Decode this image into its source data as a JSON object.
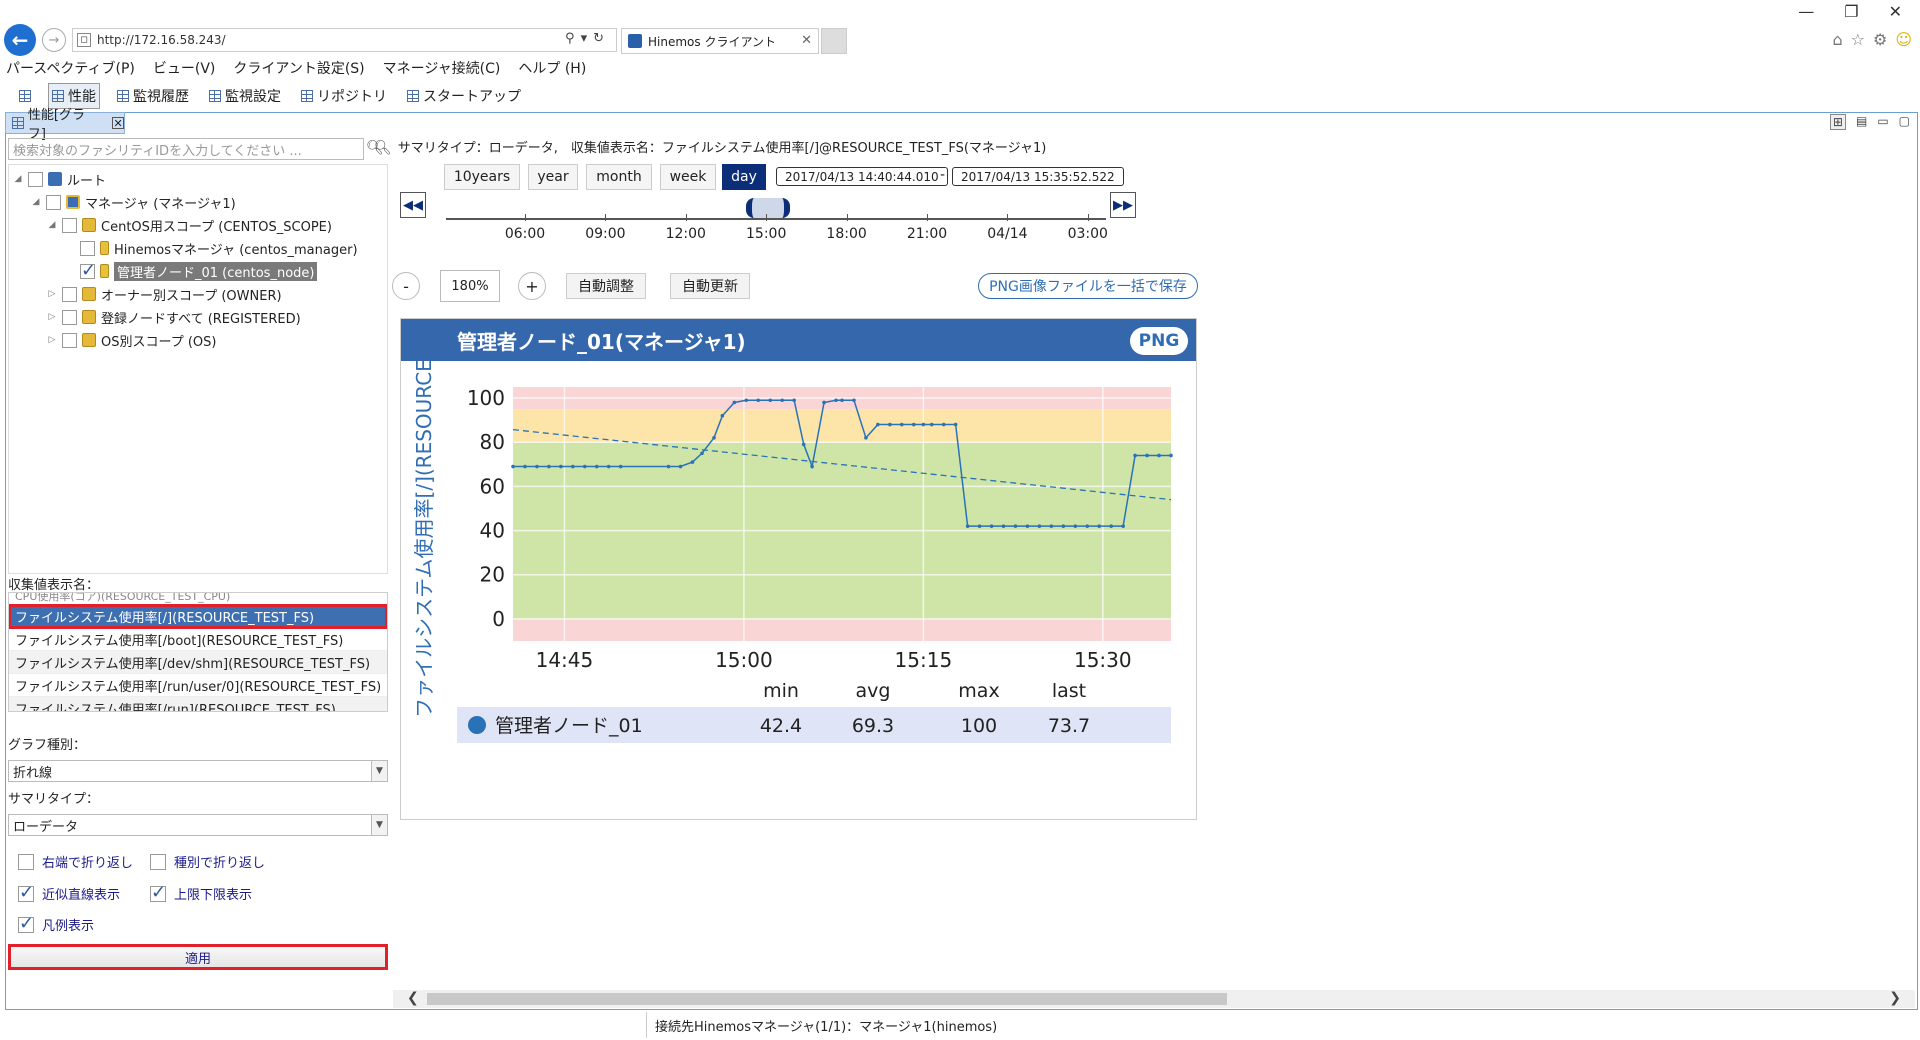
{
  "browser": {
    "url": "http://172.16.58.243/",
    "tab_title": "Hinemos クライアント",
    "window_controls": [
      "—",
      "❐",
      "✕"
    ]
  },
  "menu": [
    "パースペクティブ(P)",
    "ビュー(V)",
    "クライアント設定(S)",
    "マネージャ接続(C)",
    "ヘルプ (H)"
  ],
  "toolbar": [
    "性能",
    "監視履歴",
    "監視設定",
    "リポジトリ",
    "スタートアップ"
  ],
  "view_tab": "性能[グラフ]",
  "left": {
    "search_placeholder": "検索対象のファシリティIDを入力してください ...",
    "tree": [
      {
        "label": "ルート"
      },
      {
        "label": "マネージャ (マネージャ1)"
      },
      {
        "label": "CentOS用スコープ (CENTOS_SCOPE)"
      },
      {
        "label": "Hinemosマネージャ (centos_manager)"
      },
      {
        "label": "管理者ノード_01 (centos_node)"
      },
      {
        "label": "オーナー別スコープ (OWNER)"
      },
      {
        "label": "登録ノードすべて (REGISTERED)"
      },
      {
        "label": "OS別スコープ (OS)"
      }
    ],
    "collect_label": "収集値表示名：",
    "collect_partial_top": "CPU使用率(コア)(RESOURCE_TEST_CPU)",
    "collect_items": [
      "ファイルシステム使用率[/](RESOURCE_TEST_FS)",
      "ファイルシステム使用率[/boot](RESOURCE_TEST_FS)",
      "ファイルシステム使用率[/dev/shm](RESOURCE_TEST_FS)",
      "ファイルシステム使用率[/run/user/0](RESOURCE_TEST_FS)",
      "ファイルシステム使用率[/run](RESOURCE_TEST_FS)"
    ],
    "graph_type_label": "グラフ種別：",
    "graph_type_value": "折れ線",
    "summary_type_label": "サマリタイプ：",
    "summary_type_value": "ローデータ",
    "options": [
      {
        "label": "右端で折り返し",
        "checked": false
      },
      {
        "label": "種別で折り返し",
        "checked": false
      },
      {
        "label": "近似直線表示",
        "checked": true
      },
      {
        "label": "上限下限表示",
        "checked": true
      },
      {
        "label": "凡例表示",
        "checked": true
      }
    ],
    "apply_label": "適用"
  },
  "right": {
    "summary": "サマリタイプ：ローデータ,　収集値表示名：ファイルシステム使用率[/]@RESOURCE_TEST_FS(マネージャ1)",
    "periods": [
      "10years",
      "year",
      "month",
      "week",
      "day"
    ],
    "active_period": "day",
    "date_from": "2017/04/13 14:40:44.010",
    "date_to": "2017/04/13 15:35:52.522",
    "date_sep": "-",
    "timeline_labels": [
      "06:00",
      "09:00",
      "12:00",
      "15:00",
      "18:00",
      "21:00",
      "04/14",
      "03:00"
    ],
    "zoom_minus": "-",
    "zoom_value": "180%",
    "zoom_plus": "+",
    "auto_adjust": "自動調整",
    "auto_update": "自動更新",
    "png_save_all": "PNG画像ファイルを一括で保存",
    "card_title": "管理者ノード_01(マネージャ1)",
    "png_button": "PNG"
  },
  "chart_data": {
    "type": "line",
    "ylabel": "ファイルシステム使用率[/](RESOURCE_...",
    "ylim": [
      -10,
      105
    ],
    "yticks": [
      0,
      20,
      40,
      60,
      80,
      100
    ],
    "xlim": [
      0,
      55
    ],
    "xticks": [
      {
        "value": 4.3,
        "label": "14:45"
      },
      {
        "value": 19.3,
        "label": "15:00"
      },
      {
        "value": 34.3,
        "label": "15:15"
      },
      {
        "value": 49.3,
        "label": "15:30"
      }
    ],
    "bands": [
      {
        "from": 95,
        "to": 105,
        "color": "#f9d5d5"
      },
      {
        "from": 80,
        "to": 95,
        "color": "#fde4a8"
      },
      {
        "from": 0,
        "to": 80,
        "color": "#cfe5a8"
      },
      {
        "from": -10,
        "to": 0,
        "color": "#f9d5d5"
      }
    ],
    "series": [
      {
        "name": "管理者ノード_01",
        "color": "#2a72b8",
        "x": [
          0,
          1,
          2,
          3,
          4,
          5,
          6,
          7,
          8,
          9,
          13,
          14,
          15,
          15.8,
          16.8,
          17.5,
          18.5,
          19.5,
          20.5,
          21.5,
          22.5,
          23.5,
          24.3,
          25,
          26,
          27,
          27.5,
          28.5,
          29.5,
          30.5,
          31.5,
          32.5,
          33.5,
          34.3,
          35,
          36,
          37,
          38,
          39,
          40,
          41,
          42,
          43,
          44,
          45,
          46,
          47,
          48,
          49,
          50,
          51,
          52,
          53,
          54,
          55
        ],
        "y": [
          69,
          69,
          69,
          69,
          69,
          69,
          69,
          69,
          69,
          69,
          69,
          69,
          71,
          75,
          82,
          92,
          98,
          99,
          99,
          99,
          99,
          99,
          79,
          69,
          98,
          99,
          99,
          99,
          82,
          88,
          88,
          88,
          88,
          88,
          88,
          88,
          88,
          42,
          42,
          42,
          42,
          42,
          42,
          42,
          42,
          42,
          42,
          42,
          42,
          42,
          42,
          74,
          74,
          74,
          74
        ]
      }
    ],
    "trend": {
      "y_start": 85.7,
      "y_end": 54
    },
    "legend": {
      "headers": [
        "min",
        "avg",
        "max",
        "last"
      ],
      "rows": [
        {
          "name": "管理者ノード_01",
          "min": "42.4",
          "avg": "69.3",
          "max": "100",
          "last": "73.7"
        }
      ]
    }
  },
  "status": "接続先Hinemosマネージャ(1/1)：マネージャ1(hinemos)"
}
